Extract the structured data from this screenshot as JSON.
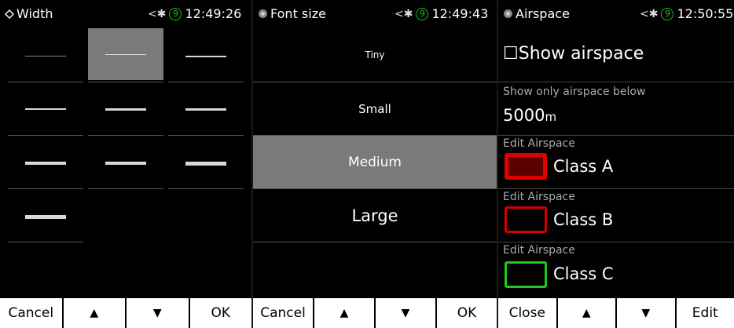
{
  "panels": {
    "width": {
      "title": "Width",
      "time": "12:49:26",
      "satellites": "9",
      "buttons": [
        "Cancel",
        "▲",
        "▼",
        "OK"
      ]
    },
    "font": {
      "title": "Font size",
      "time": "12:49:43",
      "satellites": "9",
      "options": [
        "Tiny",
        "Small",
        "Medium",
        "Large"
      ],
      "selected": "Medium",
      "buttons": [
        "Cancel",
        "▲",
        "▼",
        "OK"
      ]
    },
    "airspace": {
      "title": "Airspace",
      "time": "12:50:55",
      "satellites": "9",
      "show_airspace_label": "☐Show airspace",
      "show_below_label": "Show only airspace below",
      "show_below_value": "5000",
      "show_below_unit": "m",
      "edit_label": "Edit Airspace",
      "classes": [
        {
          "name": "Class A",
          "border": "#e00000",
          "fill": "#5a0000"
        },
        {
          "name": "Class B",
          "border": "#d40000",
          "fill": "#000000"
        },
        {
          "name": "Class C",
          "border": "#1ec81e",
          "fill": "#000000"
        }
      ],
      "buttons": [
        "Close",
        "▲",
        "▼",
        "Edit"
      ]
    }
  },
  "colors": {
    "selected": "#7a7a7a",
    "gps": "#19c219"
  }
}
